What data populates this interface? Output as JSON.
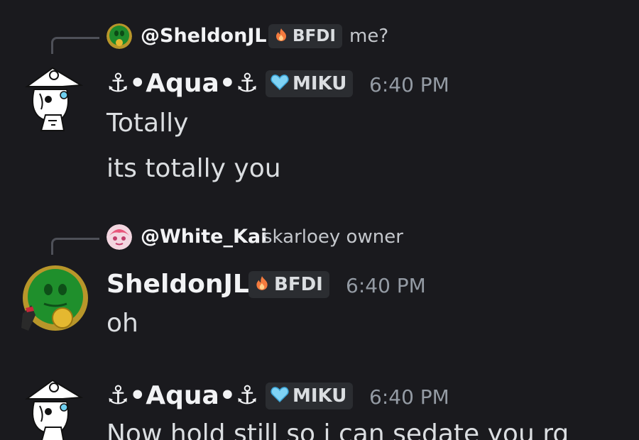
{
  "messages": [
    {
      "reply": {
        "user": "@SheldonJL",
        "role_tag": "BFDI",
        "text": "me?"
      },
      "author": "⚓•Aqua•⚓",
      "role_tag": "MIKU",
      "time": "6:40 PM",
      "lines": [
        "Totally",
        "its totally you"
      ]
    },
    {
      "reply": {
        "user": "@White_Kai",
        "text": "skarloey owner"
      },
      "author": "SheldonJL",
      "role_tag": "BFDI",
      "time": "6:40 PM",
      "lines": [
        "oh"
      ]
    },
    {
      "author": "⚓•Aqua•⚓",
      "role_tag": "MIKU",
      "time": "6:40 PM",
      "lines": [
        "Now hold still so i can sedate you rq"
      ]
    }
  ],
  "colors": {
    "background": "#1a1a1e",
    "username": "#f2f3f5",
    "text": "#dbdee1",
    "timestamp": "#949ba4",
    "tag_bg": "#2b2d31",
    "fire_icon": "#f47b3e",
    "heart_icon": "#7fd3f5"
  },
  "icons": {
    "bfdi_tag": "fire-icon",
    "miku_tag": "heart-icon"
  }
}
